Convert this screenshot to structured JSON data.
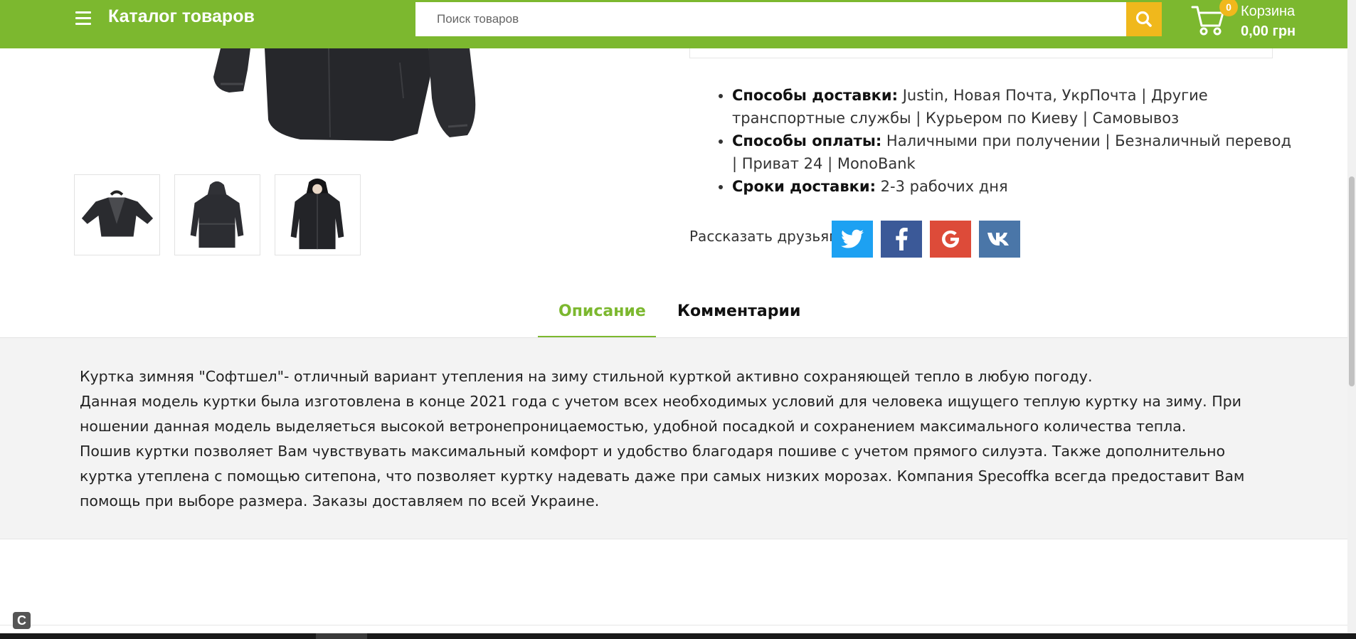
{
  "header": {
    "catalog_title": "Каталог товаров",
    "search_placeholder": "Поиск товаров",
    "cart": {
      "count": "0",
      "label": "Корзина",
      "total": "0,00 грн"
    },
    "colors": {
      "bar": "#7cb82f",
      "accent": "#f0b81c"
    }
  },
  "gallery": {
    "main_image_icon": "jacket-image",
    "thumbnails": [
      "jacket-open-thumbnail",
      "jacket-back-thumbnail",
      "jacket-front-thumbnail"
    ]
  },
  "info": {
    "items": [
      {
        "label": "Способы доставки:",
        "value": " Justin, Новая Почта, УкрПочта | Другие транспортные службы | Курьером по Киеву | Самовывоз"
      },
      {
        "label": "Способы оплаты:",
        "value": " Наличными при получении | Безналичный перевод | Приват 24 | MonoBank"
      },
      {
        "label": "Сроки доставки:",
        "value": " 2-3 рабочих дня"
      }
    ]
  },
  "share": {
    "label": "Рассказать друзьям",
    "buttons": [
      {
        "name": "twitter",
        "color": "#1da1f2"
      },
      {
        "name": "facebook",
        "color": "#3b5998"
      },
      {
        "name": "google",
        "color": "#dd4b39"
      },
      {
        "name": "vk",
        "color": "#4a76a8"
      }
    ]
  },
  "tabs": {
    "description": "Описание",
    "comments": "Комментарии"
  },
  "description": {
    "paragraphs": [
      "Куртка зимняя \"Софтшел\"- отличный вариант утепления на зиму стильной курткой активно сохраняющей тепло в любую погоду.",
      "Данная модель куртки была изготовлена в конце 2021 года с учетом всех необходимых условий для человека ищущего теплую куртку на зиму. При ношении данная модель выделяеться высокой ветронепроницаемостью, удобной посадкой и сохранением максимального количества тепла.",
      "Пошив куртки позволяет Вам чувствувать максимальный комфорт и удобство благодаря пошиве с учетом прямого силуэта. Также дополнительно куртка утеплена с помощью ситепона, что позволяет куртку надевать даже при самых низких морозах. Компания Specoffka всегда предоставит Вам помощь при выборе размера. Заказы доставляем по всей Украине."
    ]
  },
  "widget": {
    "letter": "C"
  }
}
